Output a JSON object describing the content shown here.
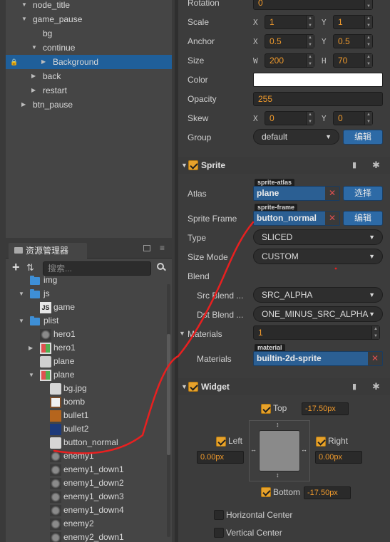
{
  "hierarchy": {
    "nodes": [
      {
        "label": "node_title",
        "indent": 1,
        "arrow": "down"
      },
      {
        "label": "game_pause",
        "indent": 1,
        "arrow": "down"
      },
      {
        "label": "bg",
        "indent": 2,
        "arrow": ""
      },
      {
        "label": "continue",
        "indent": 2,
        "arrow": "down"
      },
      {
        "label": "Background",
        "indent": 3,
        "arrow": "right",
        "selected": true,
        "locked": true
      },
      {
        "label": "back",
        "indent": 2,
        "arrow": "right"
      },
      {
        "label": "restart",
        "indent": 2,
        "arrow": "right"
      },
      {
        "label": "btn_pause",
        "indent": 1,
        "arrow": "right"
      }
    ]
  },
  "assets": {
    "title": "资源管理器",
    "search_placeholder": "搜索...",
    "items": [
      {
        "label": "img",
        "type": "folder",
        "indent": 1,
        "arrow": ""
      },
      {
        "label": "js",
        "type": "folder",
        "indent": 1,
        "arrow": "down"
      },
      {
        "label": "game",
        "type": "js",
        "indent": 2,
        "arrow": ""
      },
      {
        "label": "plist",
        "type": "folder",
        "indent": 1,
        "arrow": "down"
      },
      {
        "label": "hero1",
        "type": "sprite-dark",
        "indent": 2,
        "arrow": ""
      },
      {
        "label": "hero1",
        "type": "atlas",
        "indent": 2,
        "arrow": "right"
      },
      {
        "label": "plane",
        "type": "plist",
        "indent": 2,
        "arrow": ""
      },
      {
        "label": "plane",
        "type": "atlas",
        "indent": 2,
        "arrow": "down"
      },
      {
        "label": "bg.jpg",
        "type": "img-light",
        "indent": 3,
        "arrow": ""
      },
      {
        "label": "bomb",
        "type": "img-bomb",
        "indent": 3,
        "arrow": ""
      },
      {
        "label": "bullet1",
        "type": "img-orange",
        "indent": 3,
        "arrow": ""
      },
      {
        "label": "bullet2",
        "type": "img-blue",
        "indent": 3,
        "arrow": ""
      },
      {
        "label": "button_normal",
        "type": "img-light",
        "indent": 3,
        "arrow": ""
      },
      {
        "label": "enemy1",
        "type": "sprite-dark",
        "indent": 3,
        "arrow": ""
      },
      {
        "label": "enemy1_down1",
        "type": "sprite-dark",
        "indent": 3,
        "arrow": ""
      },
      {
        "label": "enemy1_down2",
        "type": "sprite-dark",
        "indent": 3,
        "arrow": ""
      },
      {
        "label": "enemy1_down3",
        "type": "sprite-dark",
        "indent": 3,
        "arrow": ""
      },
      {
        "label": "enemy1_down4",
        "type": "sprite-dark",
        "indent": 3,
        "arrow": ""
      },
      {
        "label": "enemy2",
        "type": "sprite-dark",
        "indent": 3,
        "arrow": ""
      },
      {
        "label": "enemy2_down1",
        "type": "sprite-dark",
        "indent": 3,
        "arrow": ""
      }
    ]
  },
  "inspector": {
    "rotation": {
      "label": "Rotation",
      "value": "0"
    },
    "scale": {
      "label": "Scale",
      "x": "1",
      "y": "1"
    },
    "anchor": {
      "label": "Anchor",
      "x": "0.5",
      "y": "0.5"
    },
    "size": {
      "label": "Size",
      "w": "200",
      "h": "70"
    },
    "color": {
      "label": "Color",
      "value": "#ffffff"
    },
    "opacity": {
      "label": "Opacity",
      "value": "255"
    },
    "skew": {
      "label": "Skew",
      "x": "0",
      "y": "0"
    },
    "group": {
      "label": "Group",
      "value": "default",
      "button": "编辑"
    },
    "axis": {
      "x": "X",
      "y": "Y",
      "w": "W",
      "h": "H"
    },
    "sprite": {
      "title": "Sprite",
      "atlas": {
        "label": "Atlas",
        "tag": "sprite-atlas",
        "value": "plane",
        "button": "选择"
      },
      "frame": {
        "label": "Sprite Frame",
        "tag": "sprite-frame",
        "value": "button_normal",
        "button": "编辑"
      },
      "type": {
        "label": "Type",
        "value": "SLICED"
      },
      "size_mode": {
        "label": "Size Mode",
        "value": "CUSTOM"
      },
      "blend": {
        "label": "Blend"
      },
      "src_blend": {
        "label": "Src Blend ...",
        "value": "SRC_ALPHA"
      },
      "dst_blend": {
        "label": "Dst Blend ...",
        "value": "ONE_MINUS_SRC_ALPHA"
      },
      "materials": {
        "label": "Materials",
        "count": "1"
      },
      "material": {
        "label": "Materials",
        "tag": "material",
        "value": "builtin-2d-sprite"
      }
    },
    "widget": {
      "title": "Widget",
      "top": {
        "label": "Top",
        "value": "-17.50px"
      },
      "left": {
        "label": "Left",
        "value": "0.00px"
      },
      "right": {
        "label": "Right",
        "value": "0.00px"
      },
      "bottom": {
        "label": "Bottom",
        "value": "-17.50px"
      },
      "hcenter": "Horizontal Center",
      "vcenter": "Vertical Center"
    }
  },
  "colors": {
    "accent": "#2d6aa6",
    "value_orange": "#f09a2c",
    "check_orange": "#e7a22b",
    "annotation_red": "#e82020"
  }
}
